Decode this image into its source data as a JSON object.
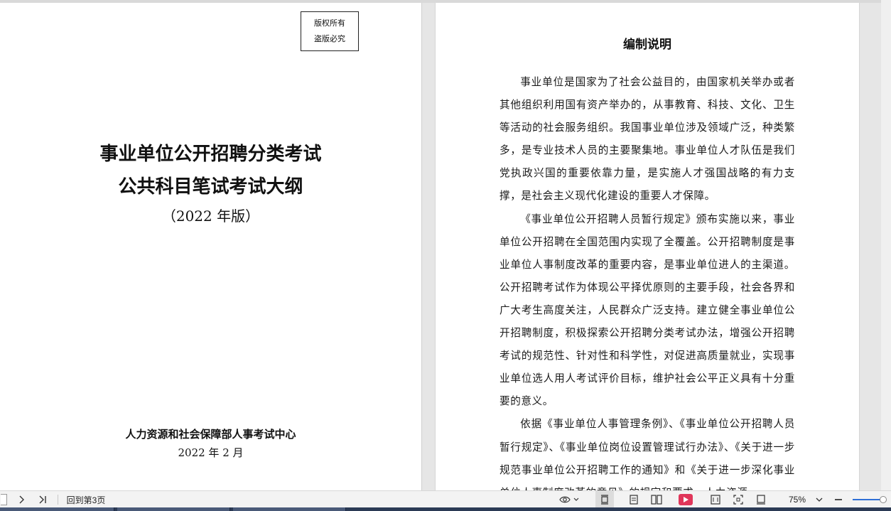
{
  "left_page": {
    "copyright_line1": "版权所有",
    "copyright_line2": "盗版必究",
    "title_line1": "事业单位公开招聘分类考试",
    "title_line2": "公共科目笔试考试大纲",
    "edition": "（2022 年版）",
    "organization": "人力资源和社会保障部人事考试中心",
    "date": "2022 年 2 月"
  },
  "right_page": {
    "heading": "编制说明",
    "paragraphs": [
      "事业单位是国家为了社会公益目的，由国家机关举办或者其他组织利用国有资产举办的，从事教育、科技、文化、卫生等活动的社会服务组织。我国事业单位涉及领域广泛，种类繁多，是专业技术人员的主要聚集地。事业单位人才队伍是我们党执政兴国的重要依靠力量，是实施人才强国战略的有力支撑，是社会主义现代化建设的重要人才保障。",
      "《事业单位公开招聘人员暂行规定》颁布实施以来，事业单位公开招聘在全国范围内实现了全覆盖。公开招聘制度是事业单位人事制度改革的重要内容，是事业单位进人的主渠道。公开招聘考试作为体现公平择优原则的主要手段，社会各界和广大考生高度关注，人民群众广泛支持。建立健全事业单位公开招聘制度，积极探索公开招聘分类考试办法，增强公开招聘考试的规范性、针对性和科学性，对促进高质量就业，实现事业单位选人用人考试评价目标，维护社会公平正义具有十分重要的意义。",
      "依据《事业单位人事管理条例》、《事业单位公开招聘人员暂行规定》、《事业单位岗位设置管理试行办法》、《关于进一步规范事业单位公开招聘工作的通知》和《关于进一步深化事业单位人事制度改革的意见》的规定和要求，人力资源"
    ]
  },
  "statusbar": {
    "next_page_icon": "chevron-right-icon",
    "last_page_icon": "last-page-icon",
    "back_to_page_label": "回到第3页",
    "eye_icon": "eye-icon",
    "single_page_icon": "single-page-icon",
    "continuous_icon": "continuous-icon",
    "dual_page_icon": "dual-page-icon",
    "play_icon": "play-icon",
    "fit_width_icon": "fit-width-icon",
    "fullscreen_icon": "fullscreen-icon",
    "fit_page_icon": "fit-page-icon",
    "zoom_value": "75%",
    "zoom_level": 0.75,
    "accent_color": "#e0365a"
  }
}
